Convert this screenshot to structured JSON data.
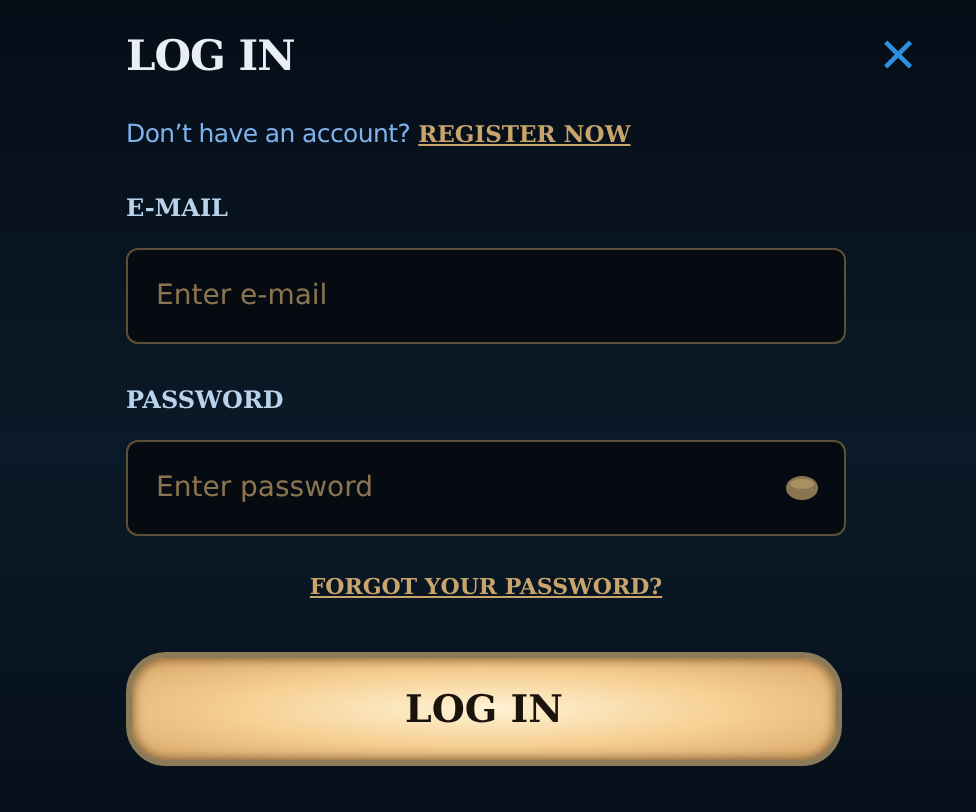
{
  "title": "LOG IN",
  "close": "✕",
  "signup": {
    "prompt": "Don’t have an account?",
    "link": "REGISTER NOW"
  },
  "fields": [
    {
      "label": "E-MAIL",
      "placeholder": "Enter e-mail",
      "kind": "text"
    },
    {
      "label": "PASSWORD",
      "placeholder": "Enter password",
      "kind": "password"
    }
  ],
  "forgot": "FORGOT YOUR PASSWORD?",
  "submit": "LOG IN"
}
